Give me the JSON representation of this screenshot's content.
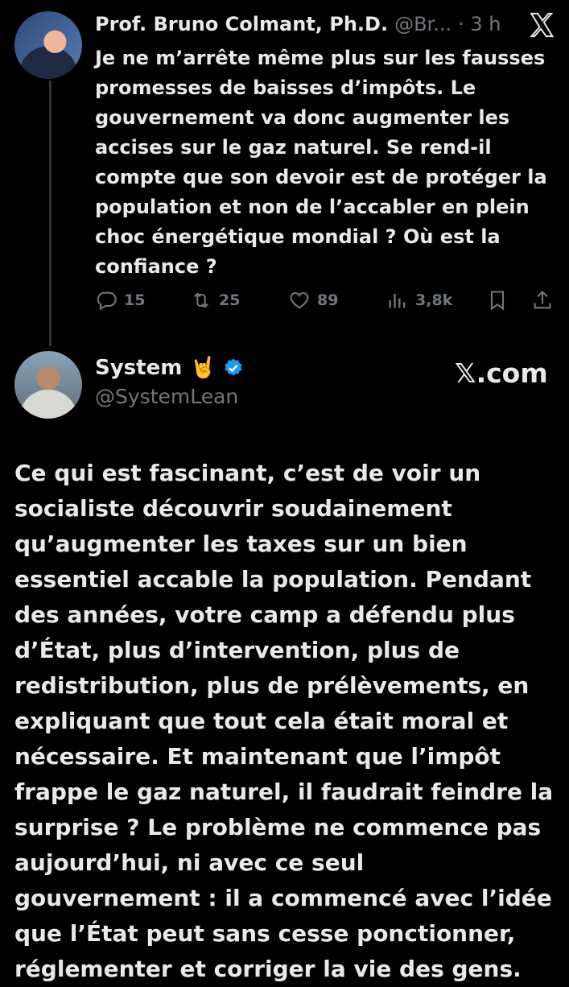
{
  "original_tweet": {
    "author_name": "Prof. Bruno Colmant, Ph.D.",
    "handle": "@Br...",
    "time": "· 3 h",
    "text": "Je ne m’arrête même plus sur les fausses promesses de baisses d’impôts. Le gouvernement va donc augmenter les accises sur le gaz naturel. Se rend-il compte que son devoir est de protéger la population et non de l’accabler en plein choc énergétique mondial ? Où est la confiance ?",
    "stats": {
      "replies": "15",
      "reposts": "25",
      "likes": "89",
      "views": "3,8k"
    },
    "icons": [
      "reply-icon",
      "repost-icon",
      "like-icon",
      "views-icon",
      "bookmark-icon",
      "share-icon",
      "x-logo-icon"
    ]
  },
  "reply_tweet": {
    "author_name": "System",
    "emoji": "🤘",
    "handle": "@SystemLean",
    "watermark": "𝕏.com",
    "text": "Ce qui est fascinant, c’est de voir un socialiste découvrir soudainement qu’augmenter les taxes sur un bien essentiel accable la population. Pendant des années, votre camp a défendu plus d’État, plus d’intervention, plus de redistribution, plus de prélèvements, en expliquant que tout cela était moral et nécessaire. Et maintenant que l’impôt frappe le gaz naturel, il faudrait feindre la surprise ? Le problème ne commence pas aujourd’hui, ni avec ce seul gouvernement : il a commencé avec l’idée que l’État peut sans cesse ponctionner, réglementer et corriger la vie des gens."
  },
  "colors": {
    "background": "#000000",
    "text": "#e7e9ea",
    "muted": "#71767b",
    "verified": "#1d9bf0"
  }
}
